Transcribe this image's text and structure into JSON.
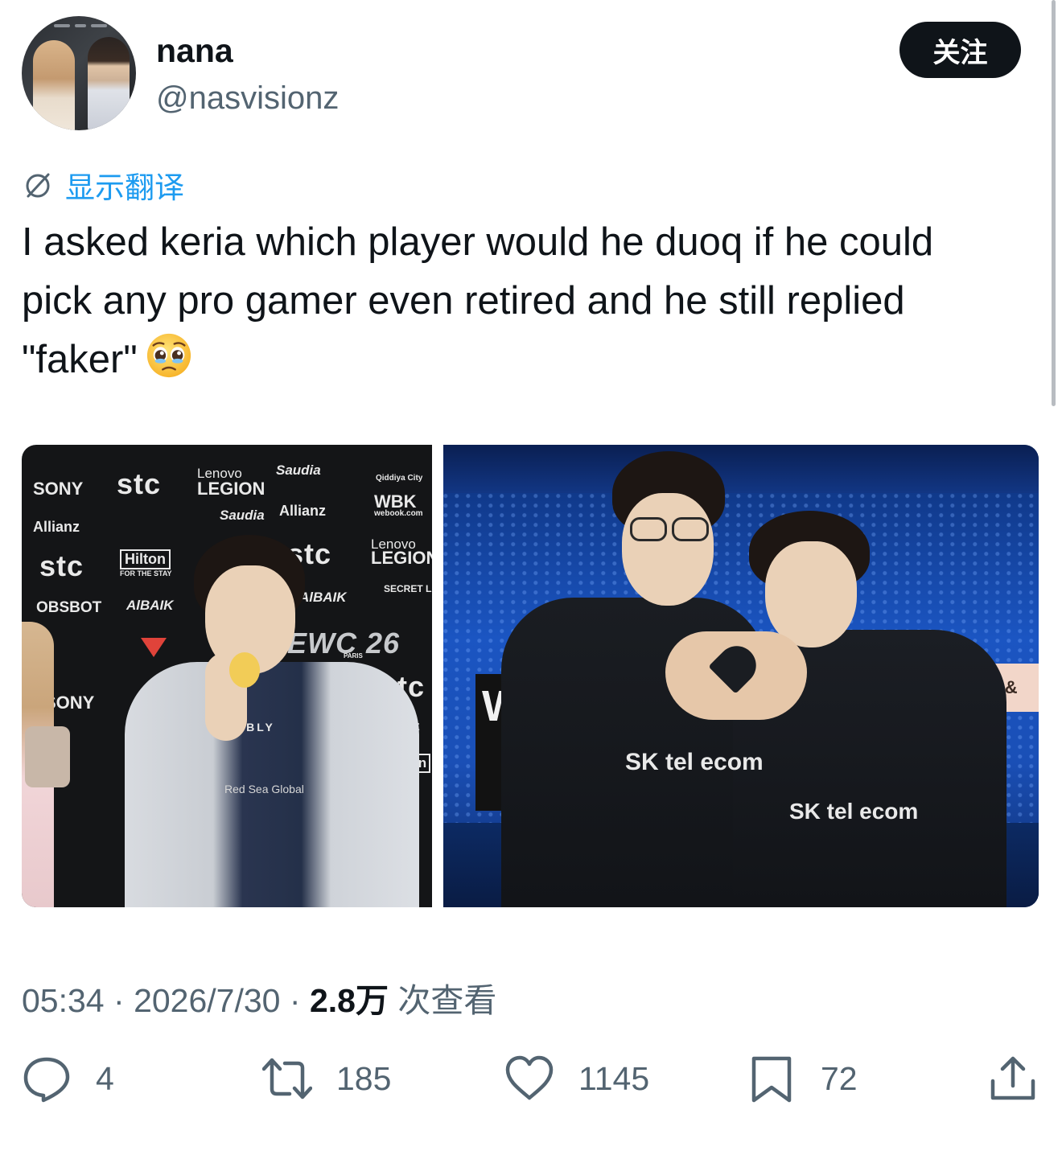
{
  "author": {
    "display_name": "nana",
    "handle": "@nasvisionz"
  },
  "follow_label": "关注",
  "translate_label": "显示翻译",
  "tweet": {
    "line1": "I asked keria which player would he duoq if he could",
    "line2": "pick any pro gamer even retired and he still replied",
    "line3": "\"faker\"",
    "emoji": "pleading-face"
  },
  "media_left": {
    "backdrop": [
      "SONY",
      "stc",
      "Lenovo",
      "LEGION",
      "Saudia",
      "Qiddiya City",
      "Allianz",
      "WBK",
      "webook.com",
      "Hilton",
      "FOR THE STAY",
      "OBSBOT",
      "AlBAIK",
      "SECRET LAB",
      "EWC 26",
      "PARIS",
      "ABLY",
      "Red Sea Global"
    ]
  },
  "media_right": {
    "signs": [
      "WO",
      "ONE &",
      "SK tel ecom"
    ]
  },
  "meta": {
    "time": "05:34",
    "dot1": "·",
    "date": "2026/7/30",
    "dot2": "·",
    "views_num": "2.8万",
    "views_label": "次查看"
  },
  "actions": {
    "replies": "4",
    "reposts": "185",
    "likes": "1145",
    "bookmarks": "72"
  },
  "colors": {
    "accent": "#1d9bf0",
    "secondary_text": "#536471",
    "primary_text": "#0f1419"
  }
}
